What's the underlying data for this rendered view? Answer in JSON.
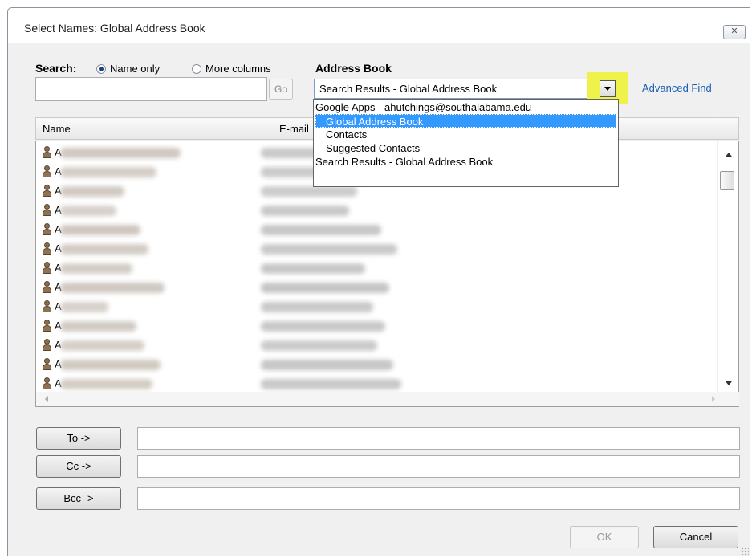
{
  "window": {
    "title": "Select Names: Global Address Book",
    "close_label": "✕"
  },
  "search": {
    "label": "Search:",
    "radio_name_only": "Name only",
    "radio_more_columns": "More columns",
    "selected": "Name only",
    "value": "",
    "go_label": "Go"
  },
  "address_book": {
    "label": "Address Book",
    "selected": "Search Results - Global Address Book",
    "advanced_find": "Advanced Find",
    "dropdown_items": [
      "Google Apps - ahutchings@southalabama.edu",
      "Global Address Book",
      "Contacts",
      "Suggested Contacts",
      "Search Results - Global Address Book"
    ],
    "highlighted_item": "Global Address Book"
  },
  "list": {
    "columns": [
      "Name",
      "E-mail"
    ],
    "rows": [
      "A",
      "A",
      "A",
      "A",
      "A",
      "A",
      "A",
      "A",
      "A",
      "A",
      "A",
      "A",
      "A"
    ]
  },
  "recipients": {
    "to_label": "To ->",
    "cc_label": "Cc ->",
    "bcc_label": "Bcc ->",
    "to_value": "",
    "cc_value": "",
    "bcc_value": ""
  },
  "actions": {
    "ok_label": "OK",
    "cancel_label": "Cancel",
    "ok_enabled": false
  },
  "colors": {
    "highlight": "#eef24a",
    "link": "#1a5fb4",
    "selection": "#3399ff"
  }
}
